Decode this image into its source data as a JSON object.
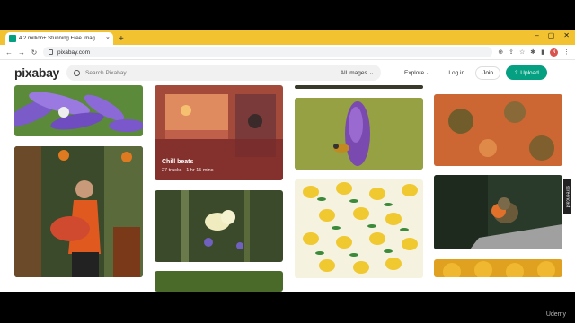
{
  "browser": {
    "tab_title": "4.2 million+ Stunning Free Imag",
    "tab_close": "×",
    "new_tab": "+",
    "url": "pixabay.com",
    "profile_initial": "N"
  },
  "header": {
    "logo": "pixabay",
    "search_placeholder": "Search Pixabay",
    "filter_label": "All images",
    "explore_label": "Explore",
    "login_label": "Log in",
    "join_label": "Join",
    "upload_label": "Upload"
  },
  "gallery": {
    "music_card": {
      "title": "Chill beats",
      "meta": "27 tracks · 1 hr 15 mins"
    }
  },
  "side_tag": "screencast",
  "watermark": "Udemy",
  "colors": {
    "accent": "#05a081",
    "tab_bar": "#f2c230"
  }
}
